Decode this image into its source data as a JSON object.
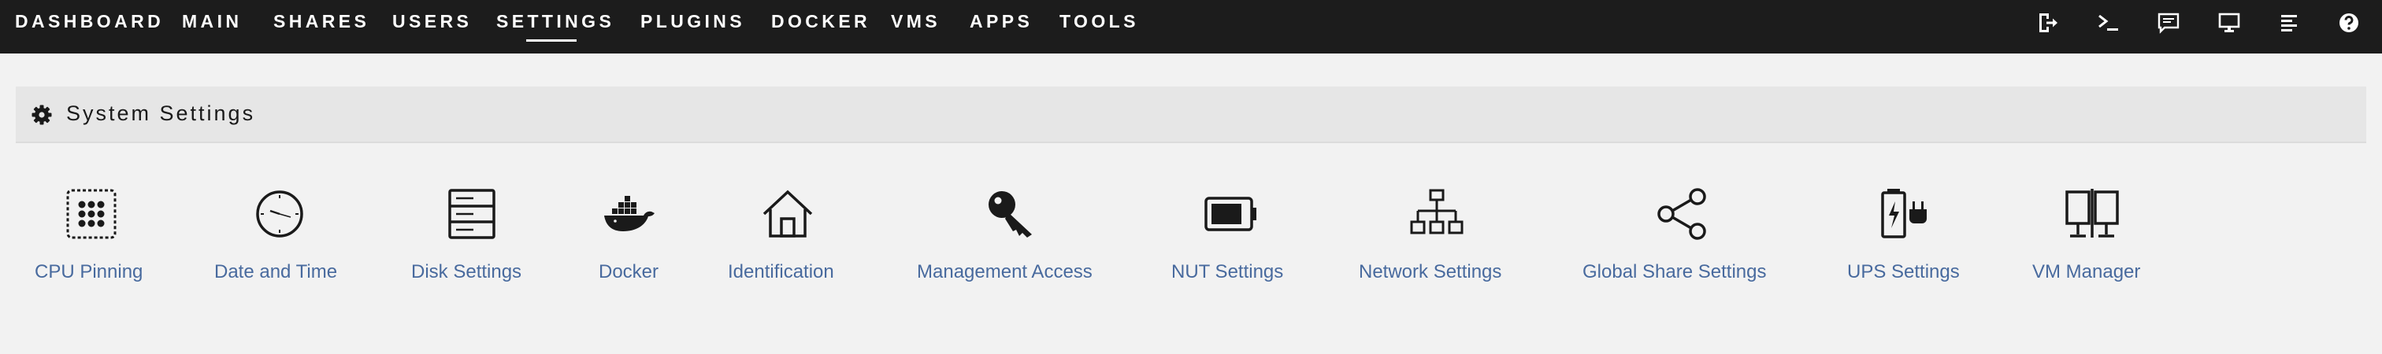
{
  "nav": {
    "items": [
      {
        "label": "DASHBOARD"
      },
      {
        "label": "MAIN"
      },
      {
        "label": "SHARES"
      },
      {
        "label": "USERS"
      },
      {
        "label": "SETTINGS",
        "active": true
      },
      {
        "label": "PLUGINS"
      },
      {
        "label": "DOCKER"
      },
      {
        "label": "VMS"
      },
      {
        "label": "APPS"
      },
      {
        "label": "TOOLS"
      }
    ]
  },
  "toolbar_icons": [
    "logout-icon",
    "terminal-icon",
    "feedback-icon",
    "monitor-icon",
    "log-icon",
    "help-icon"
  ],
  "section": {
    "icon": "gear-icon",
    "title": "System Settings"
  },
  "tiles": [
    {
      "icon": "cpu-pinning-icon",
      "label": "CPU Pinning"
    },
    {
      "icon": "clock-icon",
      "label": "Date and Time"
    },
    {
      "icon": "disk-icon",
      "label": "Disk Settings"
    },
    {
      "icon": "docker-icon",
      "label": "Docker"
    },
    {
      "icon": "home-icon",
      "label": "Identification"
    },
    {
      "icon": "key-icon",
      "label": "Management Access"
    },
    {
      "icon": "battery-icon",
      "label": "NUT Settings"
    },
    {
      "icon": "network-icon",
      "label": "Network Settings"
    },
    {
      "icon": "share-icon",
      "label": "Global Share Settings"
    },
    {
      "icon": "ups-icon",
      "label": "UPS Settings"
    },
    {
      "icon": "vm-icon",
      "label": "VM Manager"
    }
  ],
  "colors": {
    "topbar": "#1c1c1c",
    "background": "#f2f2f2",
    "link": "#486a9e"
  }
}
